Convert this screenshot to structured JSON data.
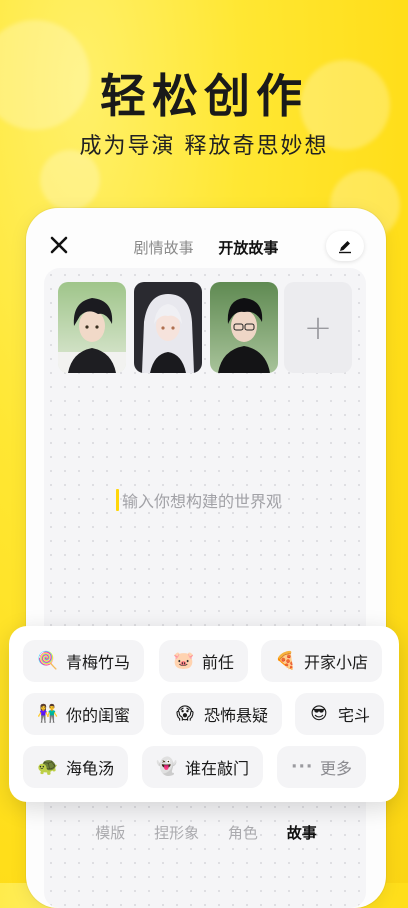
{
  "promo": {
    "headline": "轻松创作",
    "subline": "成为导演 释放奇思妙想"
  },
  "header": {
    "tabs": [
      {
        "label": "剧情故事",
        "active": false
      },
      {
        "label": "开放故事",
        "active": true
      }
    ]
  },
  "characters": [
    "character-1",
    "character-2",
    "character-3"
  ],
  "canvas": {
    "prompt": "输入你想构建的世界观"
  },
  "suggestions": [
    {
      "emoji": "🍭",
      "label": "青梅竹马"
    },
    {
      "emoji": "🐷",
      "label": "前任"
    },
    {
      "emoji": "🍕",
      "label": "开家小店"
    },
    {
      "emoji": "👫",
      "label": "你的闺蜜"
    },
    {
      "emoji": "😱",
      "label": "恐怖悬疑"
    },
    {
      "emoji": "😎",
      "label": "宅斗"
    },
    {
      "emoji": "🐢",
      "label": "海龟汤"
    },
    {
      "emoji": "👻",
      "label": "谁在敲门"
    },
    {
      "emoji": "···",
      "label": "更多"
    }
  ],
  "bottom_nav": [
    {
      "label": "模版",
      "active": false
    },
    {
      "label": "捏形象",
      "active": false
    },
    {
      "label": "角色",
      "active": false
    },
    {
      "label": "故事",
      "active": true
    }
  ],
  "colors": {
    "accent": "#ffde1a",
    "text": "#1a1a1a"
  }
}
